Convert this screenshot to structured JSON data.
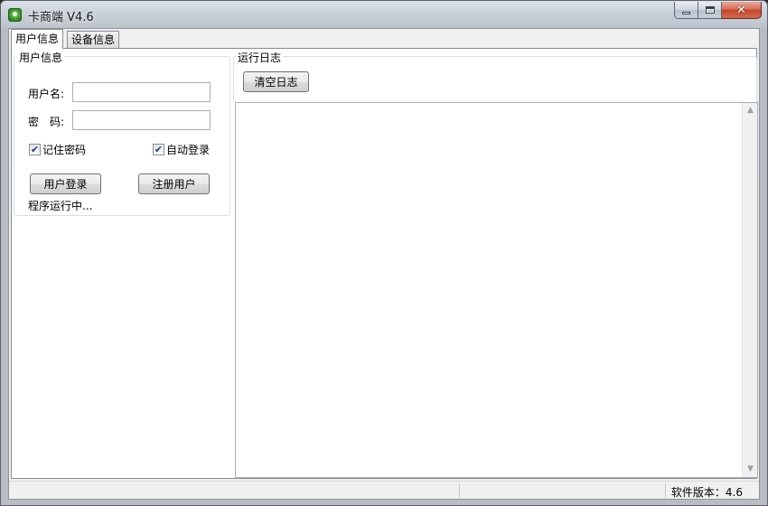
{
  "window": {
    "title": "卡商端 V4.6",
    "minimize_label": "",
    "maximize_label": "",
    "close_label": "✕"
  },
  "tabs": [
    {
      "label": "用户信息",
      "selected": true
    },
    {
      "label": "设备信息",
      "selected": false
    }
  ],
  "user_panel": {
    "group_title": "用户信息",
    "username_label": "用户名:",
    "username_value": "",
    "password_label": "密　码:",
    "password_value": "",
    "remember_password": {
      "label": "记住密码",
      "checked": true
    },
    "auto_login": {
      "label": "自动登录",
      "checked": true
    },
    "login_button": "用户登录",
    "register_button": "注册用户",
    "status_text": "程序运行中..."
  },
  "log_panel": {
    "group_title": "运行日志",
    "clear_button": "清空日志",
    "content": ""
  },
  "statusbar": {
    "version_text": "软件版本：4.6"
  },
  "colors": {
    "panel_background": "#ffffff",
    "window_frame": "#b9bec5",
    "checkmark": "#1e3f7a",
    "close_button": "#c4452c"
  }
}
